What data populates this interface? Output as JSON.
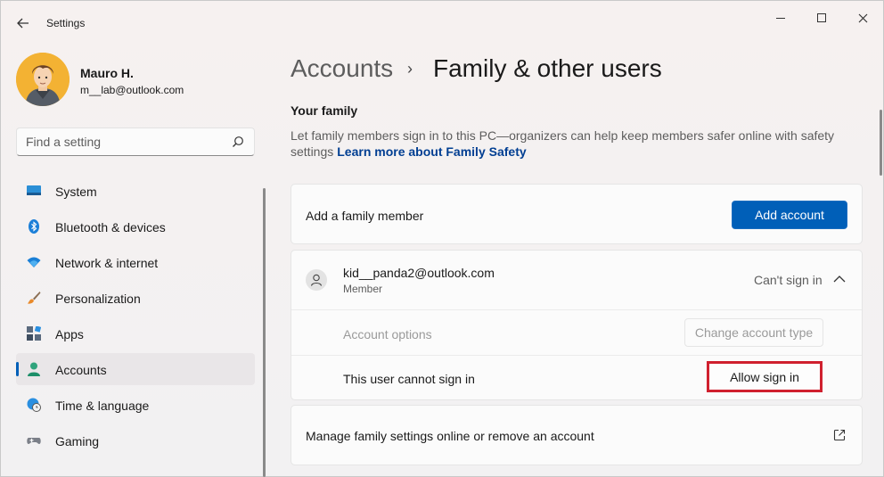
{
  "window": {
    "title": "Settings",
    "back_icon": "back-arrow-icon",
    "minimize_icon": "minimize-icon",
    "maximize_icon": "maximize-icon",
    "close_icon": "close-icon"
  },
  "profile": {
    "name": "Mauro H.",
    "email": "m__lab@outlook.com"
  },
  "search": {
    "placeholder": "Find a setting",
    "icon": "search-icon"
  },
  "sidebar": {
    "items": [
      {
        "label": "System",
        "icon": "system-icon"
      },
      {
        "label": "Bluetooth & devices",
        "icon": "bluetooth-icon"
      },
      {
        "label": "Network & internet",
        "icon": "wifi-icon"
      },
      {
        "label": "Personalization",
        "icon": "brush-icon"
      },
      {
        "label": "Apps",
        "icon": "apps-icon"
      },
      {
        "label": "Accounts",
        "icon": "accounts-icon",
        "active": true
      },
      {
        "label": "Time & language",
        "icon": "globe-clock-icon"
      },
      {
        "label": "Gaming",
        "icon": "gamepad-icon"
      }
    ]
  },
  "breadcrumb": {
    "parent": "Accounts",
    "separator": "›",
    "current": "Family & other users"
  },
  "family": {
    "title": "Your family",
    "description": "Let family members sign in to this PC—organizers can help keep members safer online with safety settings",
    "link": "Learn more about Family Safety",
    "add_label": "Add a family member",
    "add_button": "Add account",
    "member": {
      "email": "kid__panda2@outlook.com",
      "role": "Member",
      "status": "Can't sign in",
      "options_label": "Account options",
      "change_button": "Change account type",
      "cannot_label": "This user cannot sign in",
      "allow_button": "Allow sign in"
    },
    "manage_label": "Manage family settings online or remove an account"
  },
  "colors": {
    "accent": "#005fb8",
    "highlight": "#d0202e"
  }
}
